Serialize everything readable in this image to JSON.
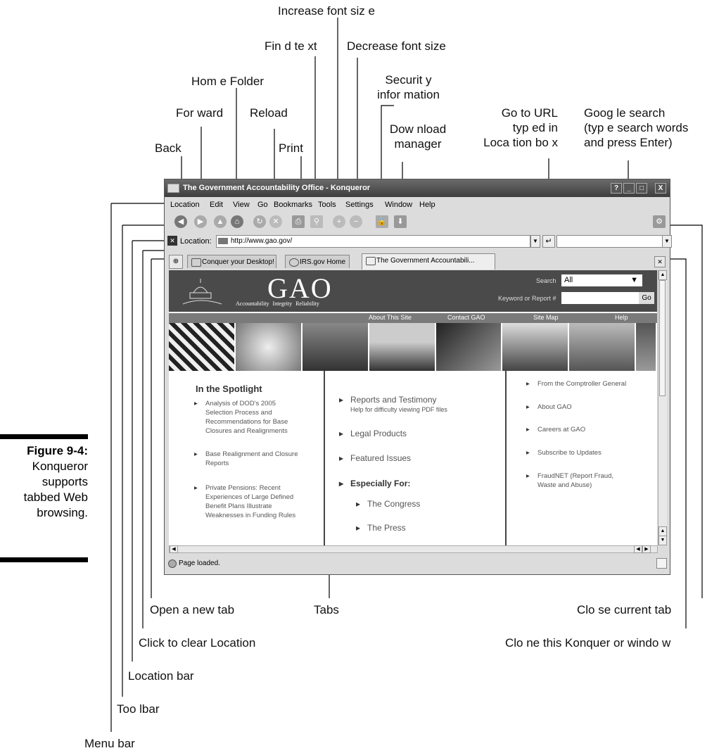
{
  "callouts": {
    "increase_font": "Increase font siz e",
    "find_text": "Fin d te xt",
    "decrease_font": "Decrease font size",
    "home_folder": "Hom e Folder",
    "security": "Securit y\ninfor mation",
    "forward": "For ward",
    "reload": "Reload",
    "go_to_url": "Go to URL\ntyp ed in\nLoca tion bo x",
    "google_search": "Goog le search\n(typ e search words\nand press Enter)",
    "download": "Dow nload\nmanager",
    "back": "Back",
    "print": "Print",
    "open_new_tab": "Open a new tab",
    "tabs": "Tabs",
    "close_current_tab": "Clo se current tab",
    "click_clear_location": "Click to clear Location",
    "clone_window": "Clo ne this Konquer or windo w",
    "location_bar": "Location bar",
    "toolbar": "Too lbar",
    "menu_bar": "Menu bar"
  },
  "figure": {
    "label": "Figure 9-4:",
    "caption": "Konqueror\nsupports\ntabbed Web\nbrowsing."
  },
  "window": {
    "title": "The Government Accountability Office - Konqueror",
    "buttons": [
      "?",
      "_",
      "□",
      "X"
    ],
    "menu": [
      "Location",
      "Edit",
      "View",
      "Go",
      "Bookmarks",
      "Tools",
      "Settings",
      "Window",
      "Help"
    ],
    "location_label": "Location:",
    "url": "http://www.gao.gov/",
    "tabs": [
      "Conquer your Desktop!",
      "IRS.gov Home",
      "The Government Accountabili..."
    ],
    "status": "Page loaded."
  },
  "toolbar_icons": [
    "back-icon",
    "forward-icon",
    "up-icon",
    "home-icon",
    "reload-icon",
    "stop-icon",
    "print-icon",
    "find-icon",
    "zoom-in-icon",
    "zoom-out-icon",
    "security-icon",
    "download-icon",
    "gear-icon"
  ],
  "site": {
    "logo": "GAO",
    "tagline": "Accountability  Integrity  Reliability",
    "search_label": "Search",
    "search_value": "All",
    "keyword_label": "Keyword or Report #",
    "go": "Go",
    "nav": [
      "About This Site",
      "Contact GAO",
      "Site Map",
      "Help"
    ],
    "spotlight_title": "In the Spotlight",
    "spotlight": [
      "Analysis of DOD's 2005\nSelection Process and\nRecommendations for Base\nClosures and Realignments",
      "Base Realignment and Closure\nReports",
      "Private Pensions: Recent\nExperiences of Large Defined\nBenefit Plans Illustrate\nWeaknesses in Funding Rules"
    ],
    "middle": {
      "reports": "Reports and Testimony",
      "reports_sub": "Help for difficulty viewing PDF files",
      "legal": "Legal Products",
      "featured": "Featured Issues",
      "especially": "Especially For:",
      "congress": "The Congress",
      "press": "The Press"
    },
    "right": [
      "From the Comptroller General",
      "About GAO",
      "Careers at GAO",
      "Subscribe to Updates",
      "FraudNET (Report Fraud,\nWaste and Abuse)"
    ]
  }
}
